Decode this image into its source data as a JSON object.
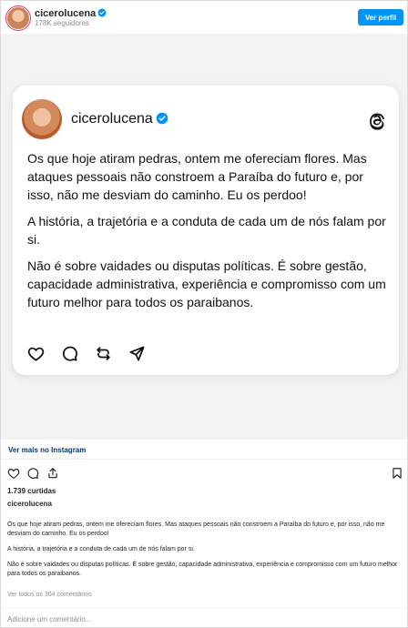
{
  "header": {
    "username": "cicerolucena",
    "followers": "178K seguidores",
    "profile_button": "Ver perfil"
  },
  "card": {
    "username": "cicerolucena",
    "paragraphs": [
      "Os que hoje atiram pedras, ontem me ofereciam flores. Mas ataques pessoais não constroem a Paraíba do futuro e, por isso, não me desviam do caminho. Eu os perdoo!",
      "A história, a trajetória e a conduta de cada um de nós falam por si.",
      "Não é sobre vaidades ou disputas políticas. É sobre gestão, capacidade administrativa, experiência e compromisso com um futuro melhor para todos os paraibanos."
    ],
    "icons": [
      "heart-icon",
      "comment-icon",
      "repost-icon",
      "share-icon",
      "threads-logo-icon"
    ]
  },
  "view_more": "Ver mais no Instagram",
  "likes": "1.739 curtidas",
  "caption": {
    "username": "cicerolucena",
    "paragraphs": [
      "Os que hoje atiram pedras, ontem me ofereciam flores. Mas ataques pessoais não constroem a Paraíba do futuro e, por isso, não me desviam do caminho. Eu os perdoo!",
      "A história, a trajetória e a conduta de cada um de nós falam por si.",
      "Não é sobre vaidades ou disputas políticas. É sobre gestão, capacidade administrativa, experiência e compromisso com um futuro melhor para todos os paraibanos."
    ]
  },
  "comments_link": "Ver todos os 304 comentários",
  "comment_placeholder": "Adicione um comentário...",
  "colors": {
    "accent": "#0095f6",
    "verified": "#0095f6",
    "link": "#00376b",
    "muted": "#8e8e8e"
  }
}
